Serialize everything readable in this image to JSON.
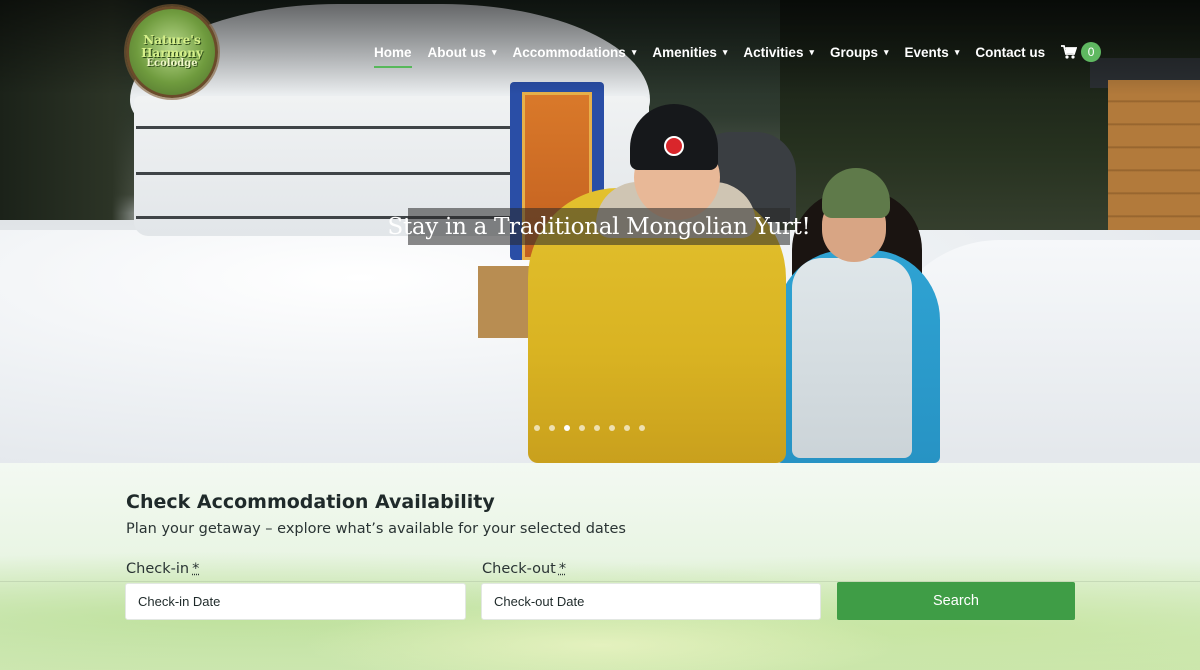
{
  "logo": {
    "line1": "Nature's",
    "line2": "Harmony",
    "line3": "Ecolodge"
  },
  "nav": {
    "items": [
      {
        "label": "Home",
        "active": true,
        "dropdown": false
      },
      {
        "label": "About us",
        "active": false,
        "dropdown": true
      },
      {
        "label": "Accommodations",
        "active": false,
        "dropdown": true
      },
      {
        "label": "Amenities",
        "active": false,
        "dropdown": true
      },
      {
        "label": "Activities",
        "active": false,
        "dropdown": true
      },
      {
        "label": "Groups",
        "active": false,
        "dropdown": true
      },
      {
        "label": "Events",
        "active": false,
        "dropdown": true
      },
      {
        "label": "Contact us",
        "active": false,
        "dropdown": false
      }
    ],
    "cart_icon": "cart-icon",
    "cart_count": "0"
  },
  "hero": {
    "caption": "Stay in a Traditional Mongolian Yurt!",
    "slide_count": 8,
    "active_slide": 2
  },
  "availability": {
    "title": "Check Accommodation Availability",
    "subtitle": "Plan your getaway – explore what’s available for your selected dates",
    "checkin_label": "Check-in",
    "checkout_label": "Check-out",
    "required_mark": "*",
    "checkin_placeholder": "Check-in Date",
    "checkout_placeholder": "Check-out Date",
    "search_label": "Search"
  },
  "colors": {
    "accent_green": "#3f9d46",
    "badge_green": "#5fb861",
    "active_underline": "#57b85a"
  }
}
